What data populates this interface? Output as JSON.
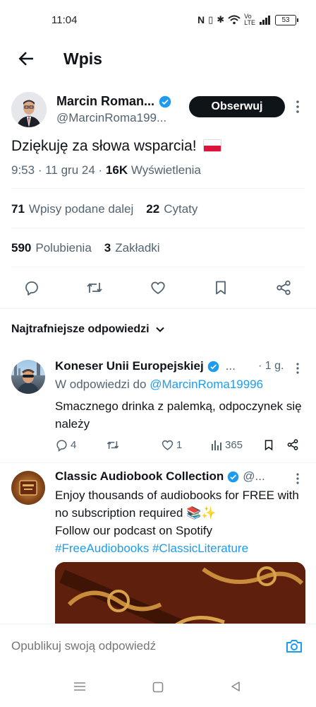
{
  "status_bar": {
    "time": "11:04",
    "battery": "53"
  },
  "header": {
    "title": "Wpis",
    "back_icon": "arrow-left-icon"
  },
  "tweet": {
    "author_name": "Marcin Roman...",
    "author_handle": "@MarcinRoma199...",
    "follow_label": "Obserwuj",
    "text": "Dziękuję za słowa wsparcia!",
    "flag": "Poland",
    "time": "9:53",
    "date": "11 gru 24",
    "views_count": "16K",
    "views_label": "Wyświetlenia",
    "reposts_count": "71",
    "reposts_label": "Wpisy podane dalej",
    "quotes_count": "22",
    "quotes_label": "Cytaty",
    "likes_count": "590",
    "likes_label": "Polubienia",
    "bookmarks_count": "3",
    "bookmarks_label": "Zakładki"
  },
  "replies_section": {
    "title": "Najtrafniejsze odpowiedzi"
  },
  "replies": [
    {
      "name": "Koneser Unii Europejskiej",
      "ellipsis": "...",
      "time": "· 1 g.",
      "context_prefix": "W odpowiedzi do",
      "context_mention": "@MarcinRoma19996",
      "text": "Smacznego drinka z palemką, odpoczynek się należy",
      "replies_count": "4",
      "likes_count": "1",
      "views_count": "365"
    },
    {
      "name": "Classic Audiobook Collection",
      "handle": "@...",
      "text_line1": "Enjoy thousands of audiobooks for FREE with no subscription required 📚✨",
      "text_line2": "Follow our podcast on Spotify",
      "hashtags": "#FreeAudiobooks #ClassicLiterature"
    }
  ],
  "compose": {
    "placeholder": "Opublikuj swoją odpowiedź"
  },
  "colors": {
    "accent": "#1d9bf0",
    "text": "#0f1419",
    "muted": "#536471",
    "divider": "#eff3f4"
  }
}
